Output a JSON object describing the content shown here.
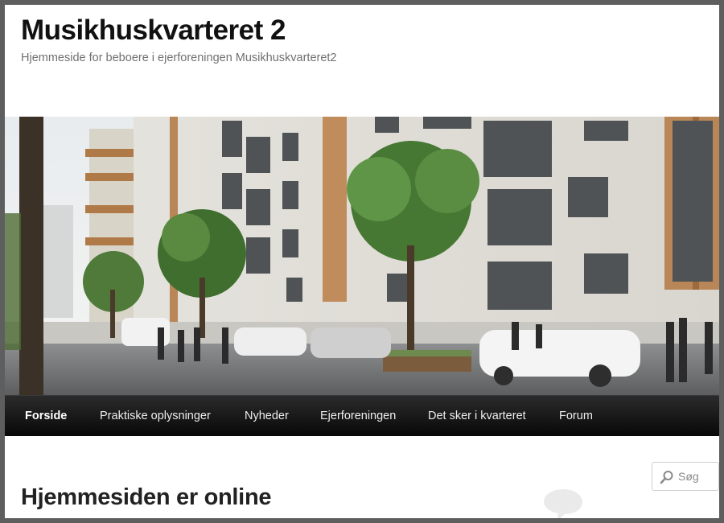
{
  "site": {
    "title": "Musikhuskvarteret 2",
    "tagline": "Hjemmeside for beboere i ejerforeningen Musikhuskvarteret2"
  },
  "banner": {
    "description_icon": "building-illustration"
  },
  "nav": {
    "items": [
      {
        "label": "Forside",
        "active": true
      },
      {
        "label": "Praktiske oplysninger",
        "active": false
      },
      {
        "label": "Nyheder",
        "active": false
      },
      {
        "label": "Ejerforeningen",
        "active": false
      },
      {
        "label": "Det sker i kvarteret",
        "active": false
      },
      {
        "label": "Forum",
        "active": false
      }
    ]
  },
  "search": {
    "placeholder": "Søg",
    "icon": "search-icon"
  },
  "post": {
    "title": "Hjemmesiden er online",
    "comment_icon": "comment-bubble-icon"
  },
  "colors": {
    "nav_bg": "#0c0c0c",
    "frame_border": "#5e5e5e",
    "title": "#111111",
    "tagline": "#707070"
  }
}
